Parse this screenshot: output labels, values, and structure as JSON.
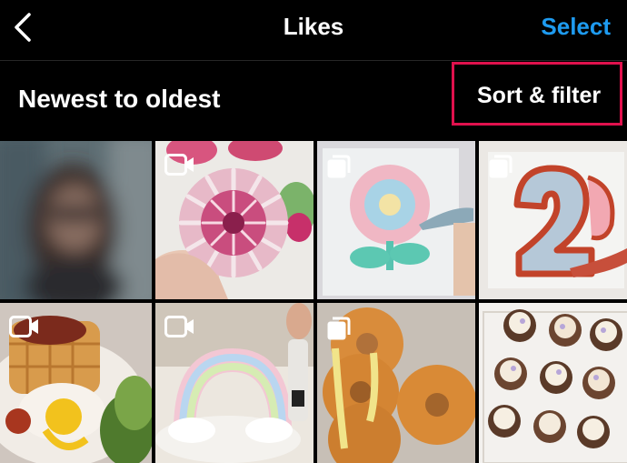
{
  "header": {
    "title": "Likes",
    "select_label": "Select",
    "back_icon": "chevron-left-icon",
    "accent": "#1e9bf0"
  },
  "sort": {
    "label": "Newest to oldest",
    "filter_label": "Sort & filter",
    "highlight_color": "#e0114d"
  },
  "tiles": [
    {
      "name": "blurred-portrait",
      "badge": "none"
    },
    {
      "name": "flower-cupcake",
      "badge": "video-icon"
    },
    {
      "name": "flower-cookie",
      "badge": "carousel-icon"
    },
    {
      "name": "number-two-cookie",
      "badge": "carousel-icon"
    },
    {
      "name": "waffle-eggs",
      "badge": "video-icon"
    },
    {
      "name": "rainbow-cake",
      "badge": "video-icon"
    },
    {
      "name": "cheese-donuts",
      "badge": "carousel-icon"
    },
    {
      "name": "cupcake-box",
      "badge": "none"
    }
  ]
}
